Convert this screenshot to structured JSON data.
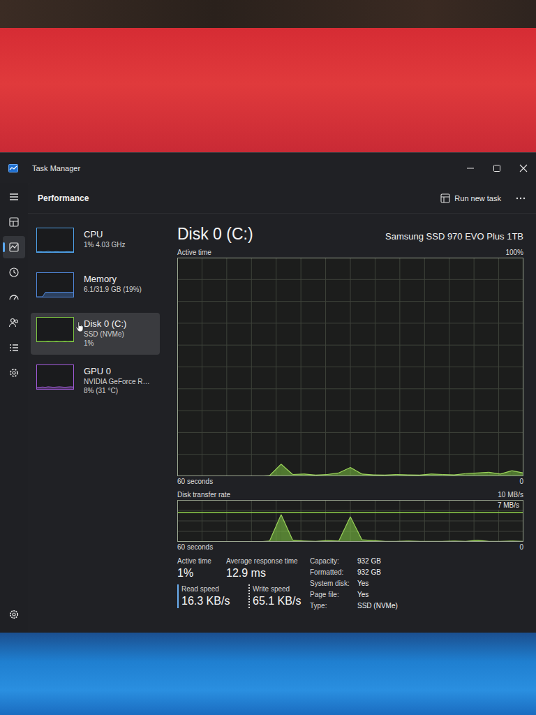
{
  "window": {
    "title": "Task Manager"
  },
  "nav": [
    {
      "kind": "menu",
      "selected": false
    },
    {
      "kind": "processes",
      "selected": false
    },
    {
      "kind": "performance",
      "selected": true
    },
    {
      "kind": "history",
      "selected": false
    },
    {
      "kind": "startup",
      "selected": false
    },
    {
      "kind": "users",
      "selected": false
    },
    {
      "kind": "details",
      "selected": false
    },
    {
      "kind": "services",
      "selected": false
    },
    {
      "kind": "settings",
      "selected": false
    }
  ],
  "header": {
    "title": "Performance",
    "run_task": "Run new task"
  },
  "devices": [
    {
      "name": "CPU",
      "lines": [
        "1% 4.03 GHz"
      ],
      "selected": false,
      "color": "#4ea0e8",
      "graph": [
        1,
        2,
        1,
        1,
        3,
        1,
        1,
        2,
        1,
        1,
        1,
        2,
        1,
        1
      ]
    },
    {
      "name": "Memory",
      "lines": [
        "6.1/31.9 GB (19%)"
      ],
      "selected": false,
      "color": "#4f86d9",
      "graph": [
        0,
        0,
        0,
        19,
        19,
        19,
        19,
        19,
        19,
        19,
        19,
        19,
        19,
        19
      ]
    },
    {
      "name": "Disk 0 (C:)",
      "lines": [
        "SSD (NVMe)",
        "1%"
      ],
      "selected": true,
      "color": "#7cc242",
      "graph": [
        0,
        0,
        0,
        0,
        1,
        0,
        0,
        1,
        0,
        0,
        1,
        0,
        1,
        1
      ]
    },
    {
      "name": "GPU 0",
      "lines": [
        "NVIDIA GeForce R…",
        "8% (31 °C)"
      ],
      "selected": false,
      "color": "#a05ad8",
      "graph": [
        6,
        7,
        8,
        7,
        9,
        8,
        7,
        8,
        9,
        8,
        7,
        8,
        9,
        8
      ]
    }
  ],
  "detail": {
    "title": "Disk 0 (C:)",
    "model": "Samsung SSD 970 EVO Plus 1TB",
    "active_chart": {
      "label": "Active time",
      "max_label": "100%",
      "time_label": "60 seconds",
      "min_label": "0",
      "max": 100,
      "values": [
        0,
        0,
        0,
        0,
        0,
        0,
        0,
        0,
        0.3,
        5.5,
        0.8,
        1,
        0.5,
        0.8,
        1.5,
        4,
        1,
        0.6,
        0.5,
        0.8,
        0.6,
        0.5,
        1,
        0.8,
        0.6,
        1.2,
        1.5,
        1.8,
        1,
        2.5,
        1.5
      ]
    },
    "transfer_chart": {
      "label": "Disk transfer rate",
      "max_label": "10 MB/s",
      "ref_label": "7 MB/s",
      "ref": 7,
      "time_label": "60 seconds",
      "min_label": "0",
      "max": 10,
      "values": [
        0,
        0,
        0,
        0,
        0,
        0,
        0,
        0,
        0.2,
        6.5,
        0.4,
        0.2,
        0.1,
        0.3,
        0.2,
        6,
        0.5,
        0.3,
        0.1,
        0.1,
        0.2,
        0.1,
        0.1,
        0.1,
        0.2,
        0.1,
        0.4,
        0.1,
        0.1,
        0.2,
        0.1
      ]
    },
    "stats": [
      {
        "label": "Active time",
        "value": "1%",
        "kind": "plain"
      },
      {
        "label": "Average response time",
        "value": "12.9 ms",
        "kind": "plain"
      },
      {
        "label": "Read speed",
        "value": "16.3 KB/s",
        "kind": "read"
      },
      {
        "label": "Write speed",
        "value": "65.1 KB/s",
        "kind": "write"
      }
    ],
    "properties": [
      {
        "label": "Capacity:",
        "value": "932 GB"
      },
      {
        "label": "Formatted:",
        "value": "932 GB"
      },
      {
        "label": "System disk:",
        "value": "Yes"
      },
      {
        "label": "Page file:",
        "value": "Yes"
      },
      {
        "label": "Type:",
        "value": "SSD (NVMe)"
      }
    ]
  }
}
